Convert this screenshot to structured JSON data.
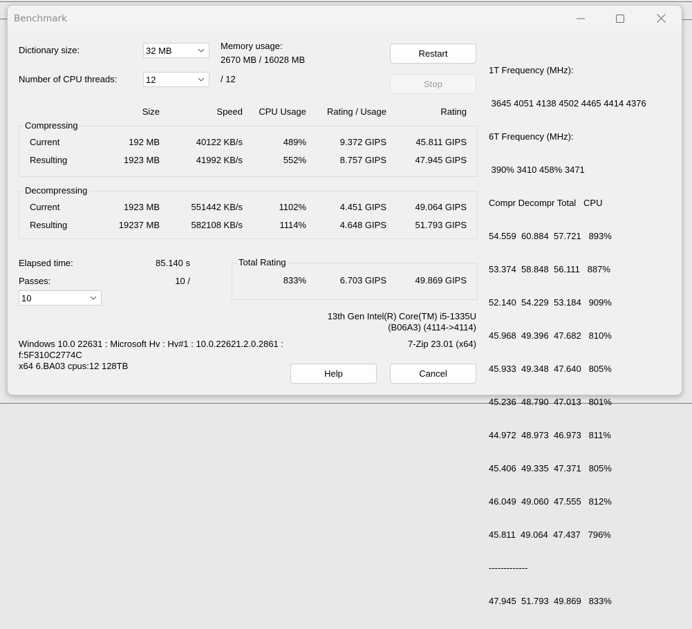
{
  "window": {
    "title": "Benchmark",
    "controls": {
      "minimize": "minimize-icon",
      "maximize": "maximize-icon",
      "close": "close-icon"
    }
  },
  "settings": {
    "dictionary_label": "Dictionary size:",
    "dictionary_value": "32 MB",
    "threads_label": "Number of CPU threads:",
    "threads_value": "12",
    "threads_max": "/ 12",
    "memory_label": "Memory usage:",
    "memory_value": "2670 MB / 16028 MB"
  },
  "buttons": {
    "restart": "Restart",
    "stop": "Stop",
    "help": "Help",
    "cancel": "Cancel"
  },
  "table": {
    "headers": [
      "Size",
      "Speed",
      "CPU Usage",
      "Rating / Usage",
      "Rating"
    ],
    "compressing": {
      "label": "Compressing",
      "rows": [
        {
          "label": "Current",
          "size": "192 MB",
          "speed": "40122 KB/s",
          "cpu": "489%",
          "rating_usage": "9.372 GIPS",
          "rating": "45.811 GIPS"
        },
        {
          "label": "Resulting",
          "size": "1923 MB",
          "speed": "41992 KB/s",
          "cpu": "552%",
          "rating_usage": "8.757 GIPS",
          "rating": "47.945 GIPS"
        }
      ]
    },
    "decompressing": {
      "label": "Decompressing",
      "rows": [
        {
          "label": "Current",
          "size": "1923 MB",
          "speed": "551442 KB/s",
          "cpu": "1102%",
          "rating_usage": "4.451 GIPS",
          "rating": "49.064 GIPS"
        },
        {
          "label": "Resulting",
          "size": "19237 MB",
          "speed": "582108 KB/s",
          "cpu": "1114%",
          "rating_usage": "4.648 GIPS",
          "rating": "51.793 GIPS"
        }
      ]
    }
  },
  "status": {
    "elapsed_label": "Elapsed time:",
    "elapsed_value": "85.140 s",
    "passes_label": "Passes:",
    "passes_value": "10 /",
    "passes_select": "10"
  },
  "total_rating": {
    "label": "Total Rating",
    "cpu": "833%",
    "rating_usage": "6.703 GIPS",
    "rating": "49.869 GIPS"
  },
  "cpu_info": {
    "line1": "13th Gen Intel(R) Core(TM) i5-1335U",
    "line2": "(B06A3) (4114->4114)",
    "version": "7-Zip 23.01 (x64)"
  },
  "sys_info": {
    "line1": "Windows 10.0 22631 : Microsoft Hv : Hv#1 : 10.0.22621.2.0.2861 :",
    "line2": "f:5F310C2774C",
    "line3": "x64 6.BA03 cpus:12 128TB"
  },
  "log": {
    "freq1_label": "1T Frequency (MHz):",
    "freq1_values": " 3645 4051 4138 4502 4465 4414 4376",
    "freq6_label": "6T Frequency (MHz):",
    "freq6_values": " 390% 3410 458% 3471",
    "header": "Compr Decompr Total   CPU",
    "rows": [
      "54.559  60.884  57.721   893%",
      "53.374  58.848  56.111   887%",
      "52.140  54.229  53.184   909%",
      "45.968  49.396  47.682   810%",
      "45.933  49.348  47.640   805%",
      "45.236  48.790  47.013   801%",
      "44.972  48.973  46.973   811%",
      "45.406  49.335  47.371   805%",
      "46.049  49.060  47.555   812%",
      "45.811  49.064  47.437   796%"
    ],
    "separator": "-------------",
    "total": "47.945  51.793  49.869   833%"
  }
}
